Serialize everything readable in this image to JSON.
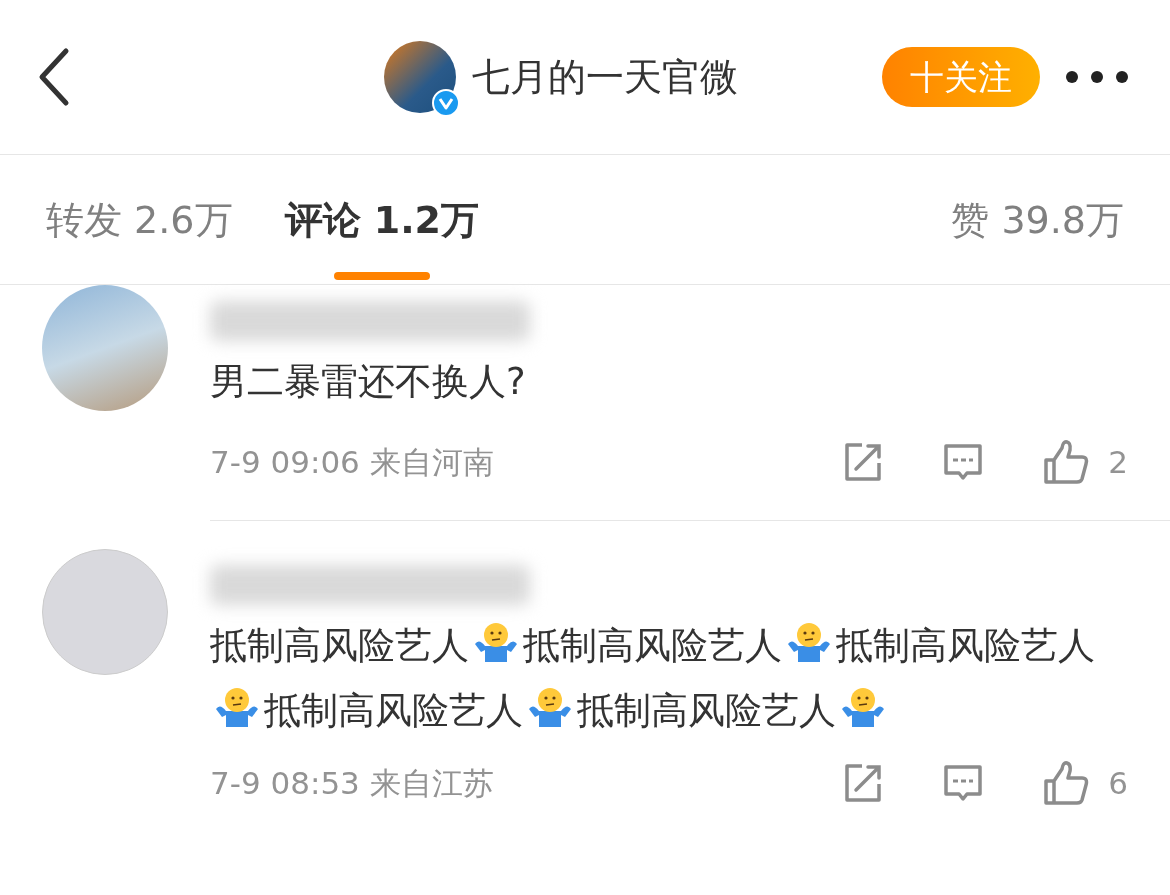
{
  "header": {
    "title": "七月的一天官微",
    "verified": true,
    "follow_button": "十关注"
  },
  "tabs": [
    {
      "label": "转发 2.6万",
      "selected": false
    },
    {
      "label": "评论 1.2万",
      "selected": true
    },
    {
      "label": "赞 39.8万",
      "selected": false
    }
  ],
  "comments": [
    {
      "avatar": {
        "kind": "photo"
      },
      "segments": [
        {
          "kind": "text",
          "text": "男二暴雷还不换人?"
        }
      ],
      "time": "7-9 09:06 来自河南",
      "likes": "2"
    },
    {
      "avatar": {
        "kind": "drawing"
      },
      "segments": [
        {
          "kind": "text",
          "text": "抵制高风险艺人"
        },
        {
          "kind": "emoji"
        },
        {
          "kind": "text",
          "text": "抵制高风险艺人"
        },
        {
          "kind": "emoji"
        },
        {
          "kind": "text",
          "text": "抵制高风险艺人"
        },
        {
          "kind": "emoji"
        },
        {
          "kind": "text",
          "text": "抵制高风险艺人"
        },
        {
          "kind": "emoji"
        },
        {
          "kind": "text",
          "text": "抵制高风险艺人"
        },
        {
          "kind": "emoji"
        }
      ],
      "time": "7-9 08:53 来自江苏",
      "likes": "6"
    }
  ]
}
